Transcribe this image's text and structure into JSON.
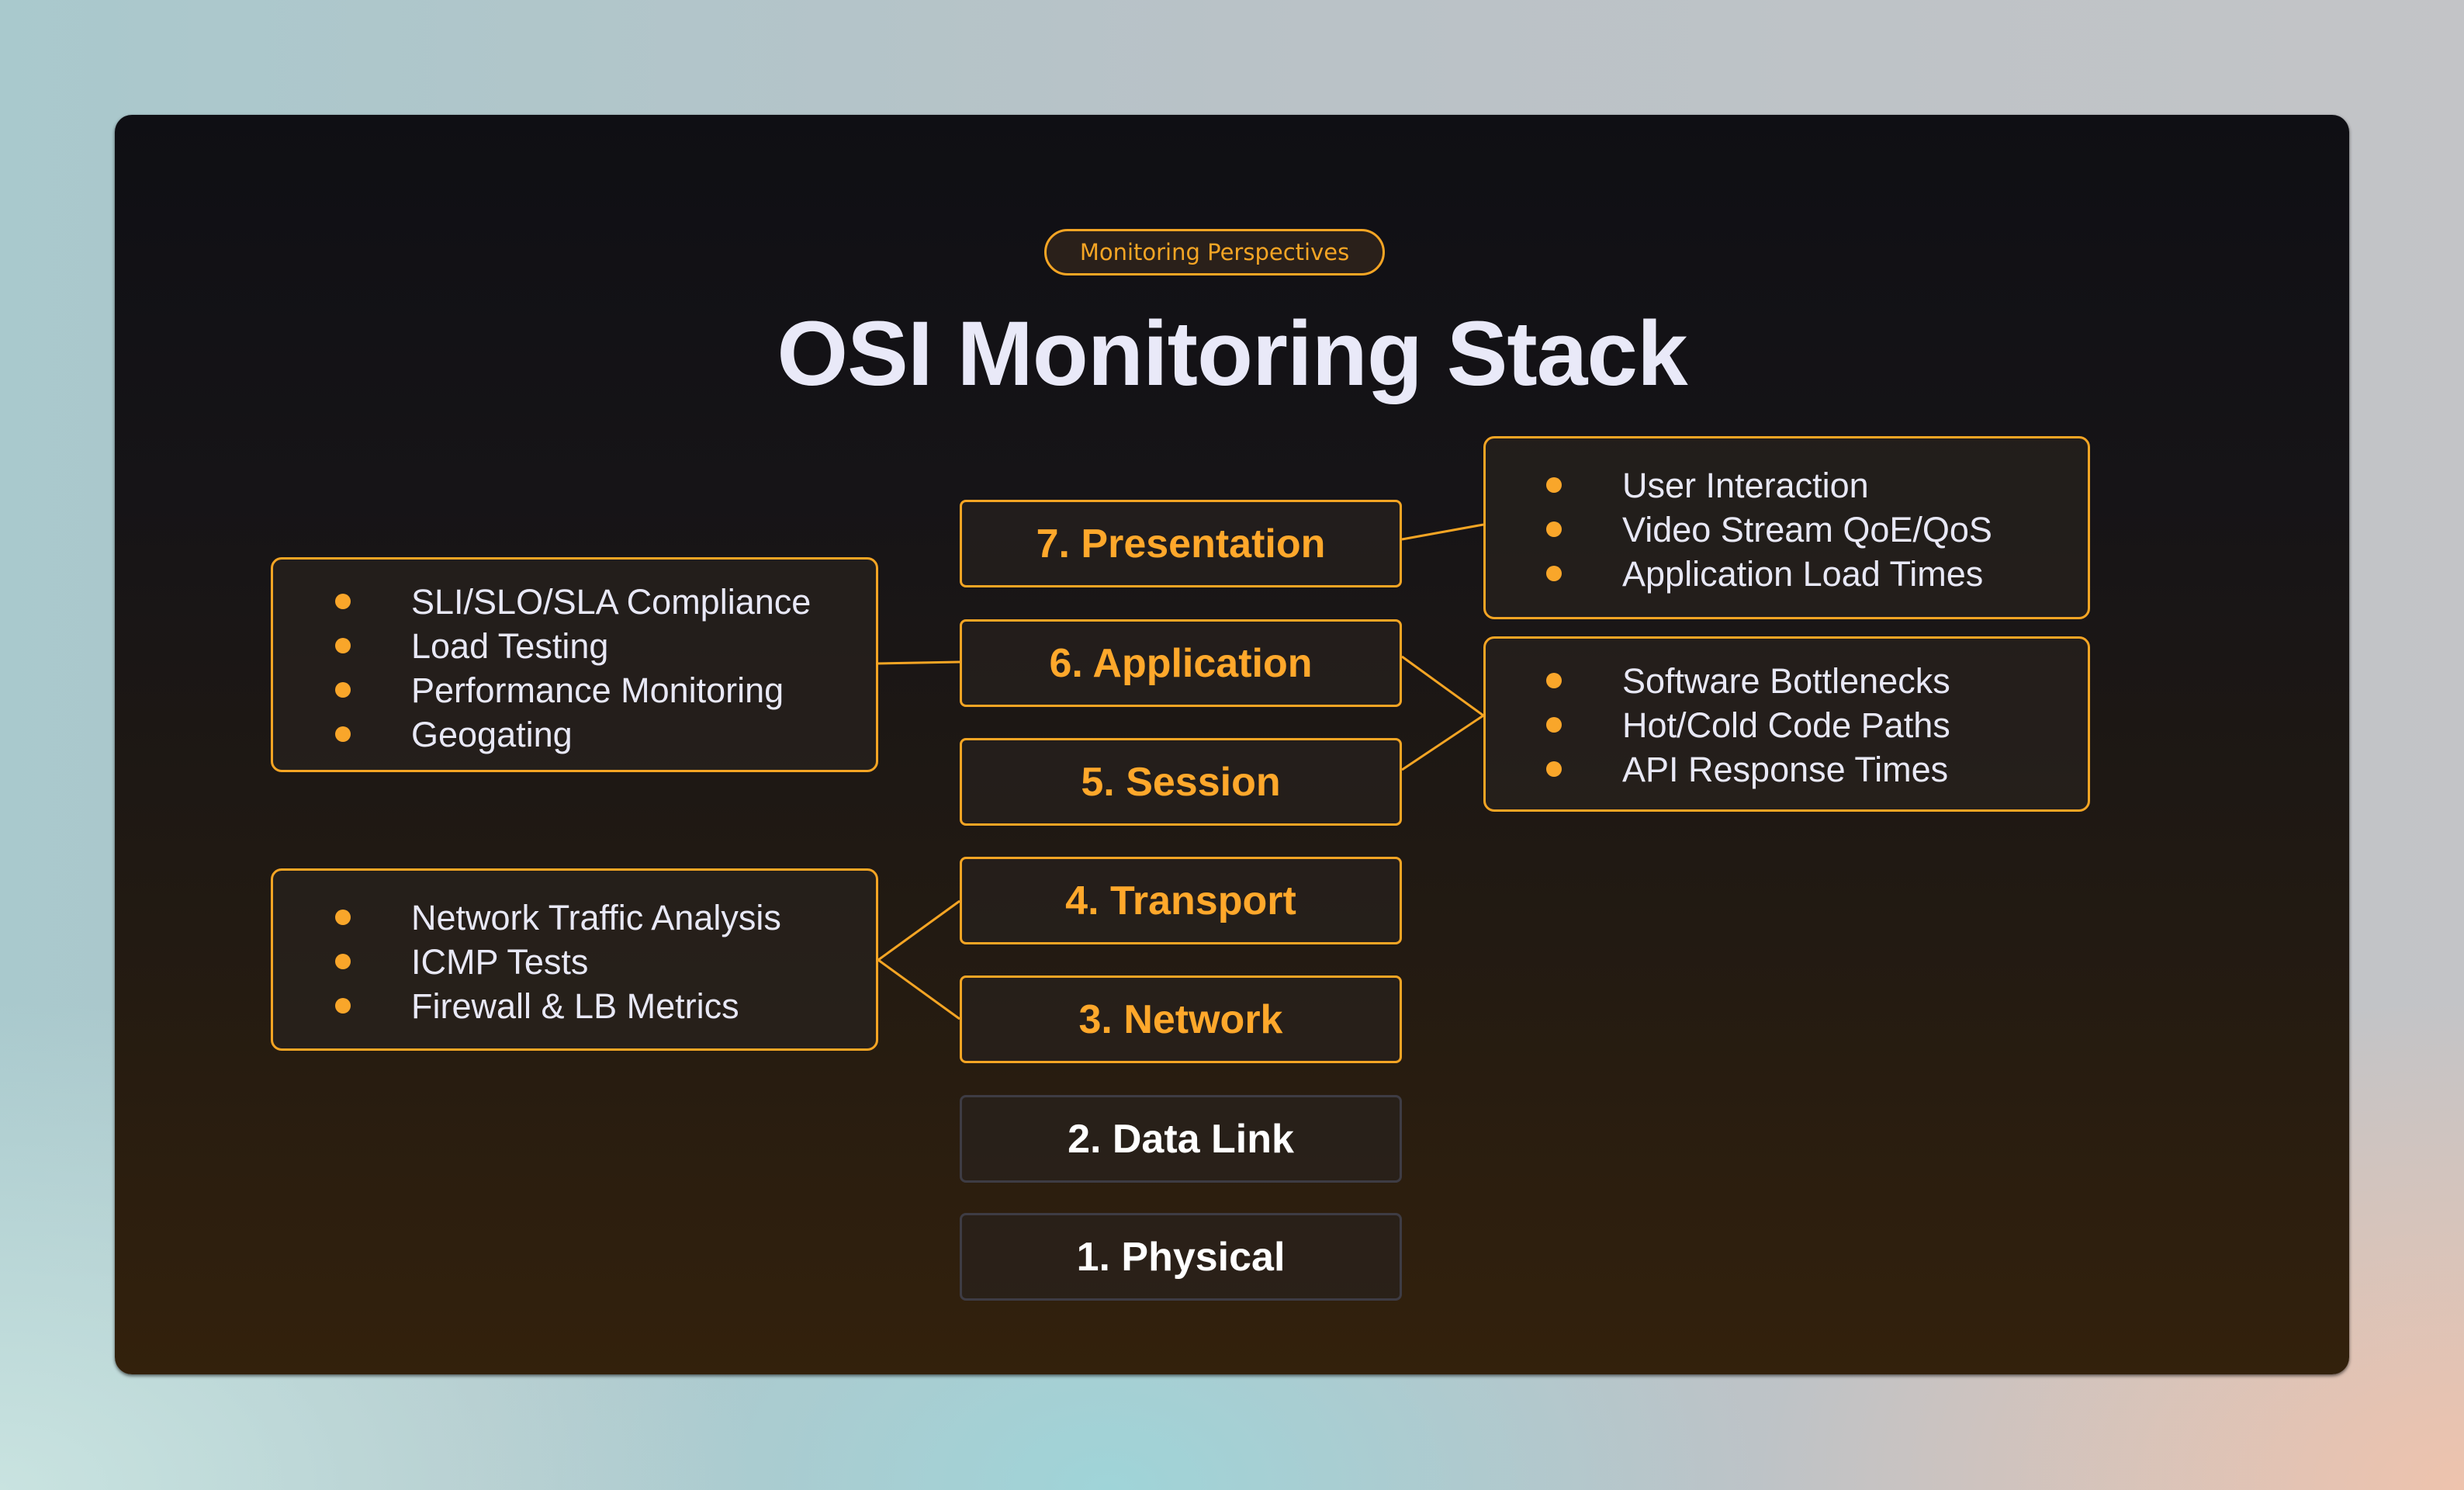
{
  "badge": "Monitoring Perspectives",
  "title": "OSI Monitoring Stack",
  "colors": {
    "accent": "#f5a524",
    "layer_text_active": "#ffa82b",
    "layer_text_muted": "#ffffff",
    "layer_border_muted": "#3e3c44",
    "bullet_text": "#e8e8f6"
  },
  "layers": [
    {
      "label": "7. Presentation",
      "highlighted": true
    },
    {
      "label": "6. Application",
      "highlighted": true
    },
    {
      "label": "5. Session",
      "highlighted": true
    },
    {
      "label": "4. Transport",
      "highlighted": true
    },
    {
      "label": "3. Network",
      "highlighted": true
    },
    {
      "label": "2. Data Link",
      "highlighted": false
    },
    {
      "label": "1. Physical",
      "highlighted": false
    }
  ],
  "callouts": {
    "left_application": {
      "connects_to": [
        "6. Application"
      ],
      "items": [
        "SLI/SLO/SLA Compliance",
        "Load Testing",
        "Performance Monitoring",
        "Geogating"
      ]
    },
    "left_network": {
      "connects_to": [
        "4. Transport",
        "3. Network"
      ],
      "items": [
        "Network Traffic Analysis",
        "ICMP Tests",
        "Firewall & LB Metrics"
      ]
    },
    "right_presentation": {
      "connects_to": [
        "7. Presentation"
      ],
      "items": [
        "User Interaction",
        "Video Stream QoE/QoS",
        "Application Load Times"
      ]
    },
    "right_application": {
      "connects_to": [
        "6. Application",
        "5. Session"
      ],
      "items": [
        "Software Bottlenecks",
        "Hot/Cold Code Paths",
        "API Response Times"
      ]
    }
  }
}
